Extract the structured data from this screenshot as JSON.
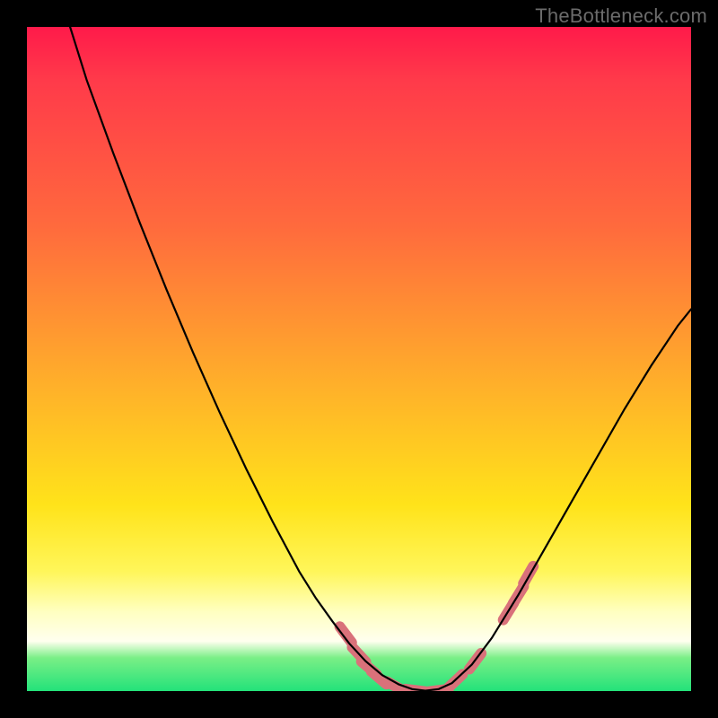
{
  "attribution": "TheBottleneck.com",
  "chart_data": {
    "type": "line",
    "title": "",
    "xlabel": "",
    "ylabel": "",
    "xlim": [
      0,
      100
    ],
    "ylim": [
      0,
      100
    ],
    "background_gradient": {
      "stops": [
        {
          "pos": 0,
          "color": "#ff1a4a"
        },
        {
          "pos": 8,
          "color": "#ff3a4a"
        },
        {
          "pos": 30,
          "color": "#ff6a3d"
        },
        {
          "pos": 55,
          "color": "#ffb329"
        },
        {
          "pos": 72,
          "color": "#ffe31a"
        },
        {
          "pos": 82,
          "color": "#fff65a"
        },
        {
          "pos": 88,
          "color": "#ffffc0"
        },
        {
          "pos": 92.5,
          "color": "#ffffef"
        },
        {
          "pos": 95,
          "color": "#7aef86"
        },
        {
          "pos": 100,
          "color": "#23e27a"
        }
      ]
    },
    "series": [
      {
        "name": "bottleneck-curve",
        "color": "#000000",
        "x": [
          6.5,
          9.0,
          13.0,
          17.0,
          21.0,
          25.0,
          29.0,
          33.0,
          37.0,
          41.0,
          43.5,
          46.0,
          48.5,
          51.0,
          53.5,
          56.0,
          58.0,
          60.0,
          62.0,
          64.0,
          67.0,
          70.0,
          74.0,
          78.0,
          82.0,
          86.0,
          90.0,
          94.0,
          98.0,
          100.0
        ],
        "y": [
          100.0,
          92.0,
          81.0,
          70.5,
          60.5,
          51.0,
          42.0,
          33.5,
          25.5,
          18.0,
          14.0,
          10.5,
          7.2,
          4.5,
          2.4,
          1.0,
          0.3,
          0.05,
          0.3,
          1.2,
          4.0,
          8.0,
          14.5,
          21.5,
          28.5,
          35.5,
          42.5,
          49.0,
          55.0,
          57.5
        ]
      }
    ],
    "markers": [
      {
        "name": "highlight-capsules",
        "color": "#d9717a",
        "points": [
          {
            "x": 48.0,
            "y": 8.5
          },
          {
            "x": 50.0,
            "y": 5.5
          },
          {
            "x": 51.5,
            "y": 3.5
          },
          {
            "x": 53.0,
            "y": 2.0
          },
          {
            "x": 55.5,
            "y": 0.7
          },
          {
            "x": 58.5,
            "y": 0.1
          },
          {
            "x": 62.0,
            "y": 0.1
          },
          {
            "x": 64.5,
            "y": 1.5
          },
          {
            "x": 67.5,
            "y": 4.5
          },
          {
            "x": 72.5,
            "y": 12.0
          },
          {
            "x": 74.0,
            "y": 14.5
          },
          {
            "x": 75.5,
            "y": 17.5
          }
        ]
      }
    ]
  }
}
